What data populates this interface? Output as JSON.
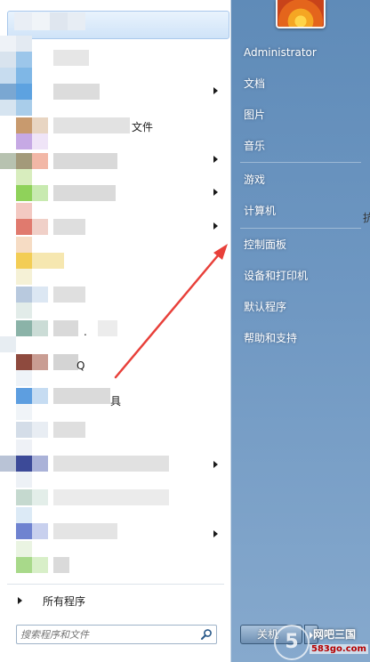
{
  "left_pane": {
    "visible_fragments": [
      {
        "id": "frag1",
        "text": "文件"
      },
      {
        "id": "frag2",
        "text": "."
      },
      {
        "id": "frag3",
        "text": "Q"
      },
      {
        "id": "frag4",
        "text": "具"
      }
    ],
    "all_programs_label": "所有程序",
    "search_placeholder": "搜索程序和文件"
  },
  "right_pane": {
    "links": [
      {
        "label": "Administrator"
      },
      {
        "label": "文档"
      },
      {
        "label": "图片"
      },
      {
        "label": "音乐"
      },
      {
        "label": "游戏"
      },
      {
        "label": "计算机"
      },
      {
        "label": "控制面板"
      },
      {
        "label": "设备和打印机"
      },
      {
        "label": "默认程序"
      },
      {
        "label": "帮助和支持"
      }
    ],
    "shutdown_label": "关机",
    "ghost_char": "抗"
  },
  "watermark": {
    "digit": "5",
    "text": "网吧三国",
    "url": "583go.com"
  },
  "colors": {
    "right_pane_top": "#5f8bb8",
    "annotation_arrow": "#e8403a"
  },
  "icons": [
    "search-icon",
    "chevron-right-icon",
    "user-picture-icon",
    "shutdown-arrow-icon"
  ]
}
